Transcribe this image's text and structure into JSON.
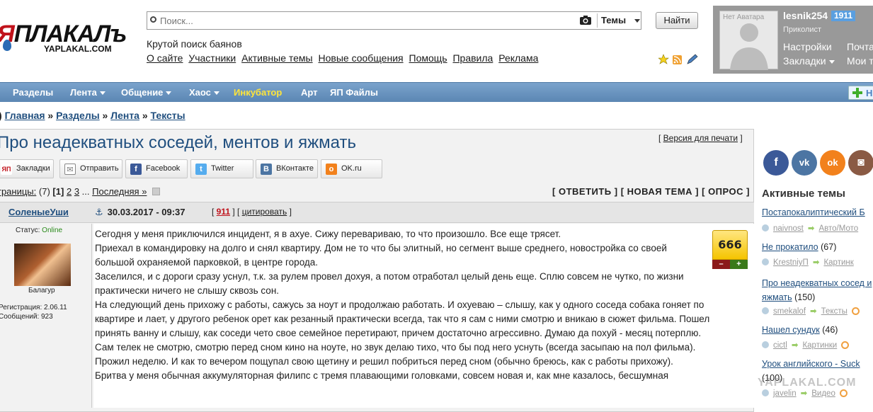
{
  "logo": {
    "wordmark_ya": "Я",
    "wordmark": "ПЛАКАЛъ",
    "domain": "YAPLAKAL.COM"
  },
  "search": {
    "placeholder": "Поиск...",
    "scope_label": "Темы",
    "submit_label": "Найти"
  },
  "tagline": "Крутой поиск баянов",
  "top_nav": [
    "О сайте",
    "Участники",
    "Активные темы",
    "Новые сообщения",
    "Помощь",
    "Правила",
    "Реклама"
  ],
  "user": {
    "avatar_placeholder": "Нет Аватара",
    "name": "lesnik254",
    "count": "1911",
    "rank": "Приколист",
    "links": [
      "Настройки",
      "Закладки"
    ],
    "links_right": [
      "Почта",
      "Мои т"
    ]
  },
  "main_nav": {
    "items": [
      {
        "label": "Разделы",
        "dropdown": false,
        "highlight": false
      },
      {
        "label": "Лента",
        "dropdown": true,
        "highlight": false
      },
      {
        "label": "Общение",
        "dropdown": true,
        "highlight": false
      },
      {
        "label": "Хаос",
        "dropdown": true,
        "highlight": false
      },
      {
        "label": "Инкубатор",
        "dropdown": false,
        "highlight": true
      },
      {
        "label": "Арт",
        "dropdown": false,
        "highlight": false
      },
      {
        "label": "ЯП Файлы",
        "dropdown": false,
        "highlight": false
      }
    ],
    "plus_label": "Н"
  },
  "breadcrumb": [
    "Главная",
    "Разделы",
    "Лента",
    "Тексты"
  ],
  "topic": {
    "title": "Про неадекватных соседей, ментов и яжмать",
    "print_version": "Версия для печати",
    "share": [
      {
        "label": "Закладки",
        "icon": "yap-icon",
        "color": "#c0121b",
        "glyph": "ЯП"
      },
      {
        "label": "Отправить",
        "icon": "mail-icon",
        "color": "#888888",
        "glyph": "✉"
      },
      {
        "label": "Facebook",
        "icon": "facebook-icon",
        "color": "#3b5998",
        "glyph": "f"
      },
      {
        "label": "Twitter",
        "icon": "twitter-icon",
        "color": "#55acee",
        "glyph": "t"
      },
      {
        "label": "ВКонтакте",
        "icon": "vk-icon",
        "color": "#4c75a3",
        "glyph": "B"
      },
      {
        "label": "OK.ru",
        "icon": "ok-icon",
        "color": "#f2811c",
        "glyph": "ok"
      }
    ],
    "pager": {
      "label": "траницы:",
      "total": "(7)",
      "current": "1",
      "pages": [
        "2",
        "3"
      ],
      "ellipsis": "...",
      "last": "Последняя »"
    },
    "actions": [
      "ОТВЕТИТЬ",
      "НОВАЯ ТЕМА",
      "ОПРОС"
    ]
  },
  "post": {
    "author": "СоленыеУши",
    "date": "30.03.2017 - 09:37",
    "number": "911",
    "quote": "цитировать",
    "status_label": "Статус:",
    "status_value": "Online",
    "role": "Балагур",
    "registered": "Регистрация: 2.06.11",
    "messages": "Сообщений: 923",
    "rating": "666",
    "rating_minus": "–",
    "rating_plus": "+",
    "paragraphs": [
      "Сегодня у меня приключился инцидент, я в ахуе. Сижу перевариваю, то что произошло. Все еще трясет.",
      "Приехал в командировку на долго и снял квартиру. Дом не то что бы элитный, но сегмент выше среднего, новостройка со своей большой охраняемой парковкой, в центре города.",
      "Заселился, и с дороги сразу уснул, т.к. за рулем провел дохуя, а потом отработал целый день еще. Сплю совсем не чутко, по жизни практически ничего не слышу сквозь сон.",
      "На следующий день прихожу с работы, сажусь за ноут и продолжаю работать. И охуеваю – слышу, как у одного соседа собака гоняет по квартире и лает, у другого ребенок орет как резанный практически всегда, так что я сам с ними смотрю и вникаю в сюжет фильма. Пошел принять ванну и слышу, как соседи чето свое семейное перетирают, причем достаточно агрессивно. Думаю да похуй - месяц потерплю.",
      "Сам телек не смотрю, смотрю перед сном кино на ноуте, но звук делаю тихо, что бы под него уснуть (всегда засыпаю на пол фильма).",
      "Прожил неделю. И как то вечером пощупал свою щетину и решил побриться перед сном (обычно бреюсь, как с работы прихожу).",
      "Бритва у меня обычная аккумуляторная филипс с тремя плавающими головками, совсем новая и, как мне казалось, бесшумная"
    ]
  },
  "sidebar": {
    "title": "Активные темы",
    "social": [
      {
        "icon": "facebook-icon",
        "color": "#3b5998",
        "glyph": "f"
      },
      {
        "icon": "vk-icon",
        "color": "#4c75a3",
        "glyph": "vk"
      },
      {
        "icon": "ok-icon",
        "color": "#f2811c",
        "glyph": "ok"
      },
      {
        "icon": "instagram-icon",
        "color": "#8a5a44",
        "glyph": "◙"
      }
    ],
    "topics": [
      {
        "title": "Постапокалиптический Б",
        "count": "",
        "author": "naivnost",
        "section": "Авто/Мото"
      },
      {
        "title": "Не прокатило",
        "count": "(67)",
        "author": "KrestniyП",
        "section": "Картинк"
      },
      {
        "title": "Про неадекватных сосед и яжмать",
        "count": "(150)",
        "author": "smekalof",
        "section": "Тексты"
      },
      {
        "title": "Нашел сундук",
        "count": "(46)",
        "author": "cictl",
        "section": "Картинки"
      },
      {
        "title": "Урок английского - Suck",
        "count": "(100)",
        "author": "javelin",
        "section": "Видео"
      }
    ]
  },
  "watermark": "YAPLAKAL.COM"
}
